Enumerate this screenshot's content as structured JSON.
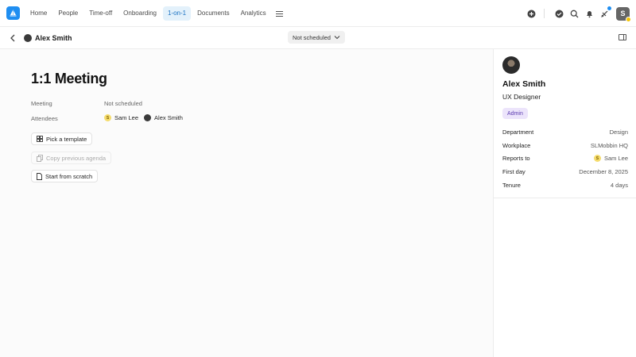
{
  "nav": {
    "items": [
      {
        "label": "Home",
        "active": false
      },
      {
        "label": "People",
        "active": false
      },
      {
        "label": "Time-off",
        "active": false
      },
      {
        "label": "Onboarding",
        "active": false
      },
      {
        "label": "1-on-1",
        "active": true
      },
      {
        "label": "Documents",
        "active": false
      },
      {
        "label": "Analytics",
        "active": false
      }
    ],
    "user_initial": "S"
  },
  "subheader": {
    "person_name": "Alex Smith",
    "schedule_status": "Not scheduled"
  },
  "main": {
    "title": "1:1 Meeting",
    "meeting_label": "Meeting",
    "meeting_value": "Not scheduled",
    "attendees_label": "Attendees",
    "attendees": [
      {
        "initial": "S",
        "name": "Sam Lee"
      },
      {
        "name": "Alex Smith"
      }
    ],
    "buttons": {
      "pick_template": "Pick a template",
      "copy_previous": "Copy previous agenda",
      "start_scratch": "Start from scratch"
    }
  },
  "profile": {
    "name": "Alex Smith",
    "role": "UX Designer",
    "badge": "Admin",
    "fields": [
      {
        "key": "Department",
        "value": "Design"
      },
      {
        "key": "Workplace",
        "value": "SLMobbin HQ"
      },
      {
        "key": "Reports to",
        "value": "Sam Lee",
        "initial": "S"
      },
      {
        "key": "First day",
        "value": "December 8, 2025"
      },
      {
        "key": "Tenure",
        "value": "4 days"
      }
    ]
  },
  "colors": {
    "accent": "#1f8ef1",
    "active_nav_bg": "#e3f1fb",
    "badge_bg": "#ece4fb",
    "badge_text": "#5b3bb0"
  }
}
